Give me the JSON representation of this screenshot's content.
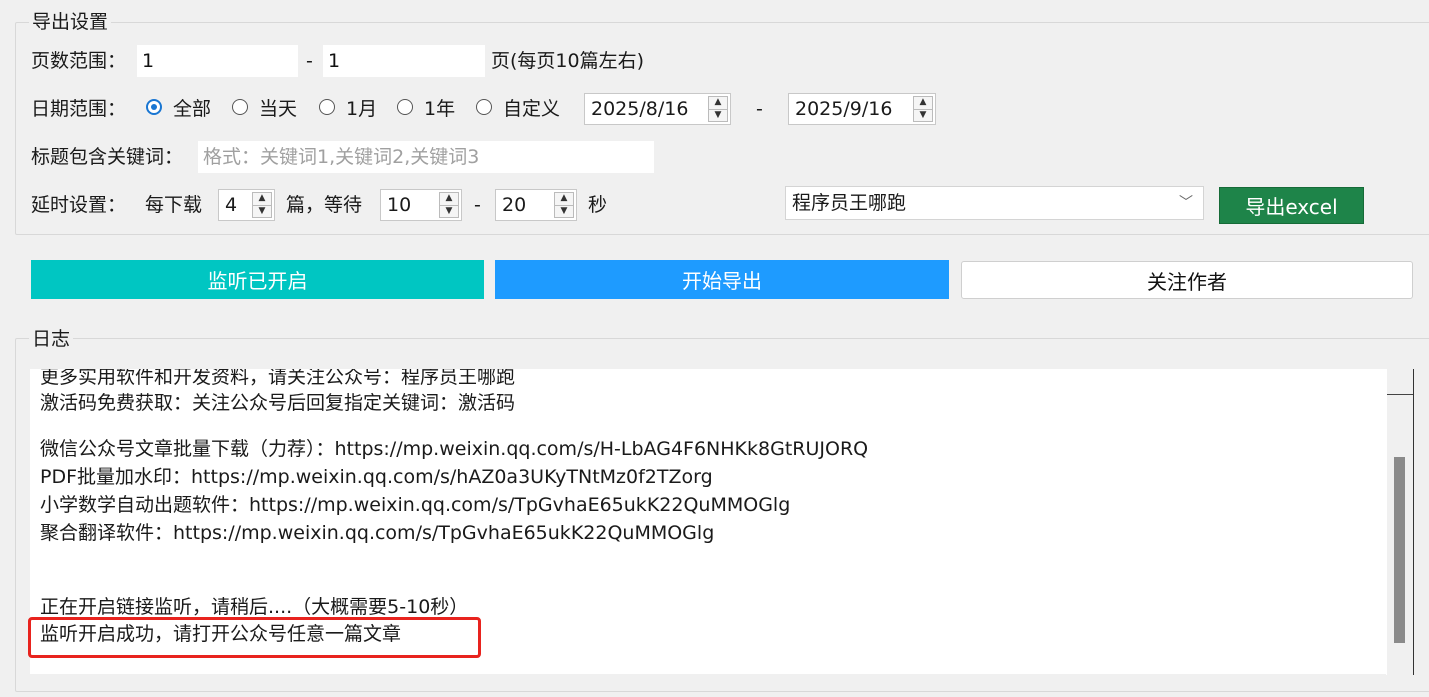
{
  "export_group": {
    "legend": "导出设置",
    "page_range": {
      "label": "页数范围：",
      "from": "1",
      "dash": "-",
      "to": "1",
      "suffix": "页(每页10篇左右)"
    },
    "date_range": {
      "label": "日期范围：",
      "options": [
        "全部",
        "当天",
        "1月",
        "1年",
        "自定义"
      ],
      "selected": "全部",
      "start": "2025/8/16",
      "dash": "-",
      "end": "2025/9/16"
    },
    "keywords": {
      "label": "标题包含关键词：",
      "placeholder": "格式：关键词1,关键词2,关键词3",
      "value": ""
    },
    "delay": {
      "label": "延时设置：",
      "per_download_label": "每下载",
      "count": "4",
      "wait_label": "篇，等待",
      "min": "10",
      "dash": "-",
      "max": "20",
      "unit": "秒"
    },
    "account_select": "程序员王哪跑",
    "export_excel_label": "导出excel"
  },
  "actions": {
    "monitor_label": "监听已开启",
    "start_export_label": "开始导出",
    "follow_author_label": "关注作者"
  },
  "log": {
    "legend": "日志",
    "lines": [
      "更多实用软件和开发资料，请关注公众号：程序员王哪跑",
      "激活码免费获取：关注公众号后回复指定关键词：激活码",
      "微信公众号文章批量下载（力荐）：https://mp.weixin.qq.com/s/H-LbAG4F6NHKk8GtRUJORQ",
      "PDF批量加水印：https://mp.weixin.qq.com/s/hAZ0a3UKyTNtMz0f2TZorg",
      "小学数学自动出题软件：https://mp.weixin.qq.com/s/TpGvhaE65ukK22QuMMOGlg",
      "聚合翻译软件：https://mp.weixin.qq.com/s/TpGvhaE65ukK22QuMMOGlg",
      "正在开启链接监听，请稍后....（大概需要5-10秒）",
      "监听开启成功，请打开公众号任意一篇文章"
    ]
  },
  "colors": {
    "monitor_bg": "#00c6c2",
    "start_export_bg": "#1e9bff",
    "export_excel_bg": "#1e8449",
    "highlight": "#e8231e"
  }
}
